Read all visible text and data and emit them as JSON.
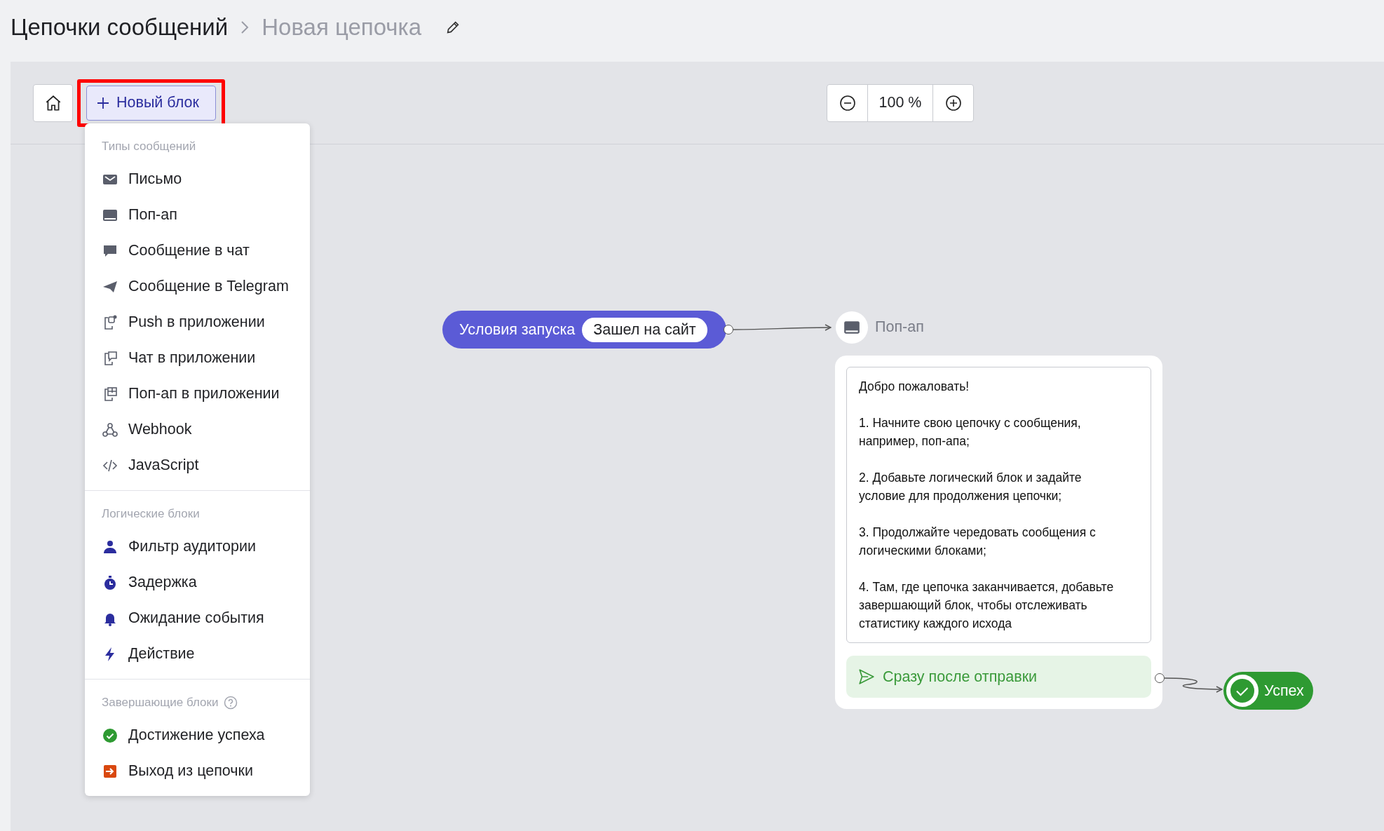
{
  "breadcrumb": {
    "parent": "Цепочки сообщений",
    "current": "Новая цепочка"
  },
  "toolbar": {
    "new_block_button": {
      "label": "Новый блок",
      "highlighted": true
    },
    "zoom": "100 %"
  },
  "menu": {
    "sections": [
      {
        "title": "Типы сообщений",
        "help": false,
        "items": [
          {
            "kind": "email",
            "label": "Письмо"
          },
          {
            "kind": "popup",
            "label": "Поп-ап"
          },
          {
            "kind": "chat",
            "label": "Сообщение в чат"
          },
          {
            "kind": "telegram",
            "label": "Сообщение в Telegram"
          },
          {
            "kind": "push",
            "label": "Push в приложении"
          },
          {
            "kind": "appchat",
            "label": "Чат в приложении"
          },
          {
            "kind": "apppopup",
            "label": "Поп-ап в приложении"
          },
          {
            "kind": "webhook",
            "label": "Webhook"
          },
          {
            "kind": "javascript",
            "label": "JavaScript"
          }
        ]
      },
      {
        "title": "Логические блоки",
        "help": false,
        "items": [
          {
            "kind": "filter",
            "label": "Фильтр аудитории"
          },
          {
            "kind": "delay",
            "label": "Задержка"
          },
          {
            "kind": "event",
            "label": "Ожидание события"
          },
          {
            "kind": "action",
            "label": "Действие"
          }
        ]
      },
      {
        "title": "Завершающие блоки",
        "help": true,
        "items": [
          {
            "kind": "success",
            "label": "Достижение успеха"
          },
          {
            "kind": "exit",
            "label": "Выход из цепочки"
          }
        ]
      }
    ]
  },
  "canvas": {
    "start_node": {
      "label": "Условия запуска",
      "trigger": "Зашел на сайт"
    },
    "message_node": {
      "kind": "popup",
      "type_label": "Поп-ап",
      "paragraphs": [
        "Добро пожаловать!",
        "1. Начните свою цепочку с сообщения, например, поп-апа;",
        "2. Добавьте логический блок и задайте условие для продолжения цепочки;",
        "3. Продолжайте чередовать сообщения с логическими блоками;",
        "4. Там, где цепочка заканчивается, добавьте завершающий блок, чтобы отслеживать статистику каждого исхода"
      ],
      "outlet": "Сразу после отправки"
    },
    "end_node": {
      "kind": "success",
      "label": "Успех"
    }
  }
}
